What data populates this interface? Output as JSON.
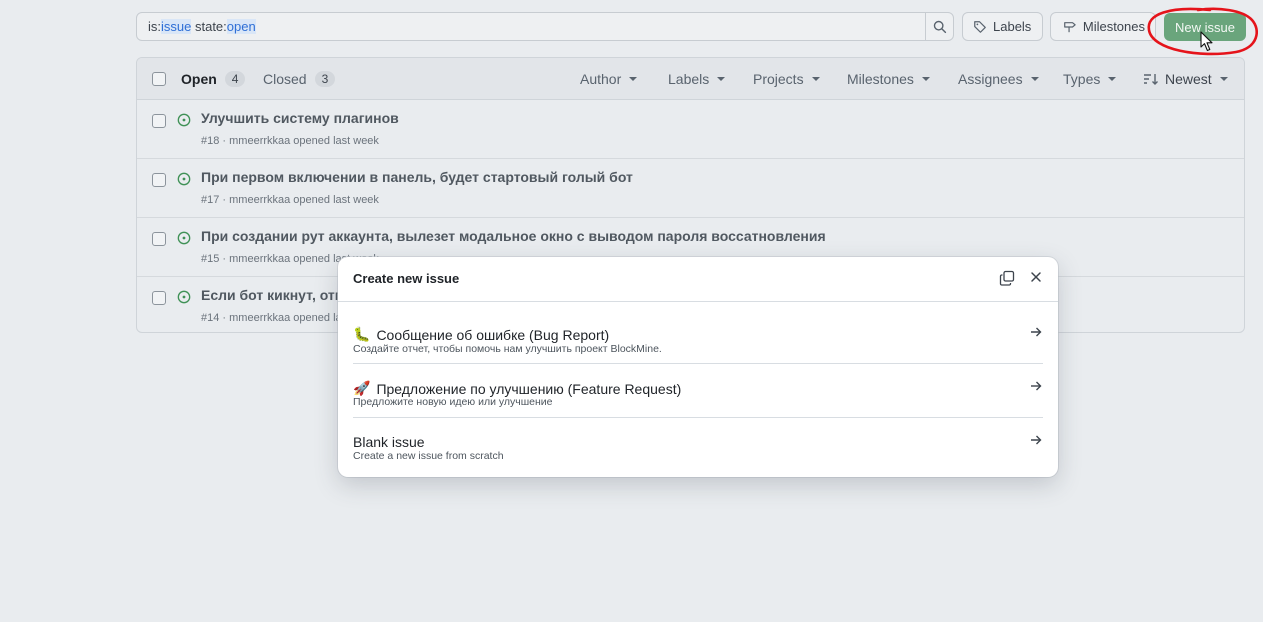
{
  "search": {
    "prefix1": "is:",
    "token1": "issue",
    "prefix2": " state:",
    "token2": "open"
  },
  "toolbar": {
    "labels": "Labels",
    "milestones": "Milestones",
    "new_issue": "New issue"
  },
  "list": {
    "open_label": "Open",
    "open_count": "4",
    "closed_label": "Closed",
    "closed_count": "3",
    "filters": [
      "Author",
      "Labels",
      "Projects",
      "Milestones",
      "Assignees",
      "Types",
      "Newest"
    ],
    "issues": [
      {
        "title": "Улучшить систему плагинов",
        "meta": "#18 · mmeerrkkaa opened last week"
      },
      {
        "title": "При первом включении в панель, будет стартовый голый бот",
        "meta": "#17 · mmeerrkkaa opened last week"
      },
      {
        "title": "При создании рут аккаунта, вылезет модальное окно с выводом пароля воссатновления",
        "meta": "#15 · mmeerrkkaa opened last week"
      },
      {
        "title": "Если бот кикнут, отп",
        "meta": "#14 · mmeerrkkaa opened last"
      }
    ]
  },
  "modal": {
    "title": "Create new issue",
    "templates": [
      {
        "emoji": "🐛",
        "title": "Сообщение об ошибке (Bug Report)",
        "desc": "Создайте отчет, чтобы помочь нам улучшить проект BlockMine."
      },
      {
        "emoji": "🚀",
        "title": "Предложение по улучшению (Feature Request)",
        "desc": "Предложите новую идею или улучшение"
      },
      {
        "emoji": "",
        "title": "Blank issue",
        "desc": "Create a new issue from scratch"
      }
    ]
  },
  "colors": {
    "accent_green": "#6aa57c",
    "open_icon": "#3f9156",
    "annotation_red": "#e5141b"
  }
}
